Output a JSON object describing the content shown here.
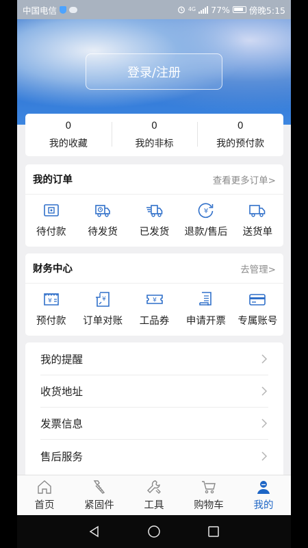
{
  "status_bar": {
    "carrier": "中国电信",
    "battery": "77%",
    "time": "傍晚5:15",
    "network": "4G"
  },
  "header": {
    "login_label": "登录/注册"
  },
  "stats": [
    {
      "value": "0",
      "label": "我的收藏"
    },
    {
      "value": "0",
      "label": "我的非标"
    },
    {
      "value": "0",
      "label": "我的预付款"
    }
  ],
  "orders": {
    "title": "我的订单",
    "more_label": "查看更多订单>",
    "items": [
      {
        "label": "待付款",
        "icon": "wallet-icon"
      },
      {
        "label": "待发货",
        "icon": "box-clock-icon"
      },
      {
        "label": "已发货",
        "icon": "truck-icon"
      },
      {
        "label": "退款/售后",
        "icon": "refund-icon"
      },
      {
        "label": "送货单",
        "icon": "delivery-truck-icon"
      }
    ]
  },
  "finance": {
    "title": "财务中心",
    "manage_label": "去管理>",
    "items": [
      {
        "label": "预付款",
        "icon": "prepay-icon"
      },
      {
        "label": "订单对账",
        "icon": "reconcile-icon"
      },
      {
        "label": "工品券",
        "icon": "coupon-icon"
      },
      {
        "label": "申请开票",
        "icon": "invoice-icon"
      },
      {
        "label": "专属账号",
        "icon": "card-icon"
      }
    ]
  },
  "menu": [
    {
      "label": "我的提醒"
    },
    {
      "label": "收货地址"
    },
    {
      "label": "发票信息"
    },
    {
      "label": "售后服务"
    }
  ],
  "tabs": [
    {
      "label": "首页",
      "icon": "home-icon",
      "active": false
    },
    {
      "label": "紧固件",
      "icon": "screw-icon",
      "active": false
    },
    {
      "label": "工具",
      "icon": "wrench-icon",
      "active": false
    },
    {
      "label": "购物车",
      "icon": "cart-icon",
      "active": false
    },
    {
      "label": "我的",
      "icon": "user-icon",
      "active": true
    }
  ],
  "colors": {
    "accent": "#1d65c5",
    "icon_blue": "#2f6fc9",
    "background": "#f0f0f2"
  }
}
